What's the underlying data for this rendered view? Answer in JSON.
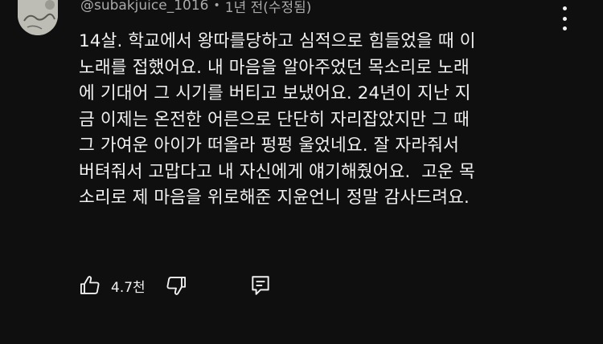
{
  "comment": {
    "author": "@subakjuice_1016",
    "separator": "•",
    "time": "1년 전(수정됨)",
    "lines": [
      "14살. 학교에서 왕따를당하고 심적으로 힘들었을 때 이",
      "노래를 접했어요. 내 마음을 알아주었던 목소리로 노래",
      "에 기대어 그 시기를 버티고 보냈어요. 24년이 지난 지",
      "금 이제는 온전한 어른으로 단단히 자리잡았지만 그 때",
      "그 가여운 아이가 떠올라 펑펑 울었네요. 잘 자라줘서",
      "버텨줘서 고맙다고 내 자신에게 얘기해줬어요.  고운 목",
      "소리로 제 마음을 위로해준 지윤언니 정말 감사드려요."
    ],
    "like_count": "4.7천"
  },
  "icons": {
    "more": "more-vert-icon",
    "like": "thumb-up-icon",
    "dislike": "thumb-down-icon",
    "reply": "reply-comment-icon"
  },
  "colors": {
    "background": "#0f0f0f",
    "text": "#f1f1f1",
    "secondary_text": "#aaaaaa"
  }
}
